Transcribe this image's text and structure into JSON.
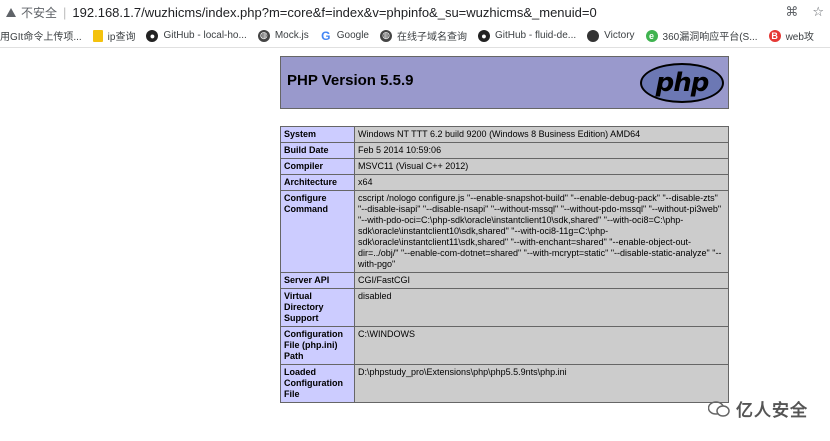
{
  "browser": {
    "security_label": "不安全",
    "url": "192.168.1.7/wuzhicms/index.php?m=core&f=index&v=phpinfo&_su=wuzhicms&_menuid=0",
    "icons": [
      "translate-icon",
      "bookmark-star-icon"
    ]
  },
  "bookmarks": [
    {
      "label": "用GIt命令上传项...",
      "icon": "none"
    },
    {
      "label": "ip查询",
      "icon": "folder-icon"
    },
    {
      "label": "GitHub - local-ho...",
      "icon": "github-icon"
    },
    {
      "label": "Mock.js",
      "icon": "globe-icon"
    },
    {
      "label": "Google",
      "icon": "google-icon"
    },
    {
      "label": "在线子域名查询",
      "icon": "globe-icon"
    },
    {
      "label": "GitHub - fluid-de...",
      "icon": "github-icon"
    },
    {
      "label": "Victory",
      "icon": "victory-icon"
    },
    {
      "label": "360漏洞响应平台(S...",
      "icon": "360-icon"
    },
    {
      "label": "web攻",
      "icon": "red-icon"
    }
  ],
  "php": {
    "title": "PHP Version 5.5.9",
    "logo_text": "php",
    "rows": [
      {
        "key": "System",
        "value": "Windows NT TTT 6.2 build 9200 (Windows 8 Business Edition) AMD64"
      },
      {
        "key": "Build Date",
        "value": "Feb 5 2014 10:59:06"
      },
      {
        "key": "Compiler",
        "value": "MSVC11 (Visual C++ 2012)"
      },
      {
        "key": "Architecture",
        "value": "x64"
      },
      {
        "key": "Configure Command",
        "value": "cscript /nologo configure.js \"--enable-snapshot-build\" \"--enable-debug-pack\" \"--disable-zts\" \"--disable-isapi\" \"--disable-nsapi\" \"--without-mssql\" \"--without-pdo-mssql\" \"--without-pi3web\" \"--with-pdo-oci=C:\\php-sdk\\oracle\\instantclient10\\sdk,shared\" \"--with-oci8=C:\\php-sdk\\oracle\\instantclient10\\sdk,shared\" \"--with-oci8-11g=C:\\php-sdk\\oracle\\instantclient11\\sdk,shared\" \"--with-enchant=shared\" \"--enable-object-out-dir=../obj/\" \"--enable-com-dotnet=shared\" \"--with-mcrypt=static\" \"--disable-static-analyze\" \"--with-pgo\""
      },
      {
        "key": "Server API",
        "value": "CGI/FastCGI"
      },
      {
        "key": "Virtual Directory Support",
        "value": "disabled"
      },
      {
        "key": "Configuration File (php.ini) Path",
        "value": "C:\\WINDOWS"
      },
      {
        "key": "Loaded Configuration File",
        "value": "D:\\phpstudy_pro\\Extensions\\php\\php5.5.9nts\\php.ini"
      }
    ]
  },
  "watermark": {
    "text": "亿人安全"
  }
}
